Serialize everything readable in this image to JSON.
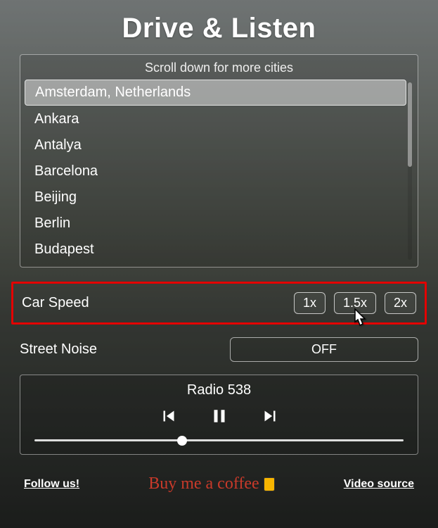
{
  "title": "Drive & Listen",
  "cityPanel": {
    "header": "Scroll down for more cities",
    "cities": [
      {
        "name": "Amsterdam, Netherlands",
        "selected": true
      },
      {
        "name": "Ankara",
        "selected": false
      },
      {
        "name": "Antalya",
        "selected": false
      },
      {
        "name": "Barcelona",
        "selected": false
      },
      {
        "name": "Beijing",
        "selected": false
      },
      {
        "name": "Berlin",
        "selected": false
      },
      {
        "name": "Budapest",
        "selected": false
      }
    ]
  },
  "carSpeed": {
    "label": "Car Speed",
    "options": [
      "1x",
      "1.5x",
      "2x"
    ]
  },
  "streetNoise": {
    "label": "Street Noise",
    "state": "OFF"
  },
  "radio": {
    "station": "Radio 538"
  },
  "footer": {
    "follow": "Follow us!",
    "coffee": "Buy me a coffee",
    "video": "Video source"
  }
}
